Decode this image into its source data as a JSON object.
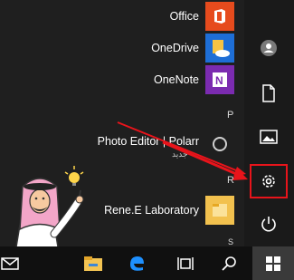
{
  "apps": [
    {
      "label": "Office",
      "icon": "office-icon",
      "tile_color": "#e64b1d"
    },
    {
      "label": "OneDrive",
      "icon": "onedrive-icon",
      "tile_color": "#1e6ed6"
    },
    {
      "label": "OneNote",
      "icon": "onenote-icon",
      "tile_color": "#7b2bb0"
    },
    {
      "label": "Photo Editor | Polarr",
      "sublabel": "جديد",
      "icon": "polarr-icon",
      "tile_color": "#1f1f1f"
    },
    {
      "label": "Rene.E Laboratory",
      "icon": "folder-icon",
      "tile_color": "#f2c14e"
    }
  ],
  "letters": [
    "P",
    "R",
    "S"
  ],
  "rail": {
    "items": [
      "avatar-icon",
      "document-icon",
      "pictures-icon",
      "settings-icon",
      "power-icon"
    ]
  },
  "taskbar": {
    "items": [
      "mail-icon",
      "file-explorer-icon",
      "edge-icon",
      "task-view-icon",
      "search-icon",
      "start-icon"
    ]
  },
  "colors": {
    "accent_highlight": "#e8141b",
    "arrow": "#e8141b",
    "panel_bg": "#1f1f1f",
    "taskbar_bg": "#101010"
  }
}
